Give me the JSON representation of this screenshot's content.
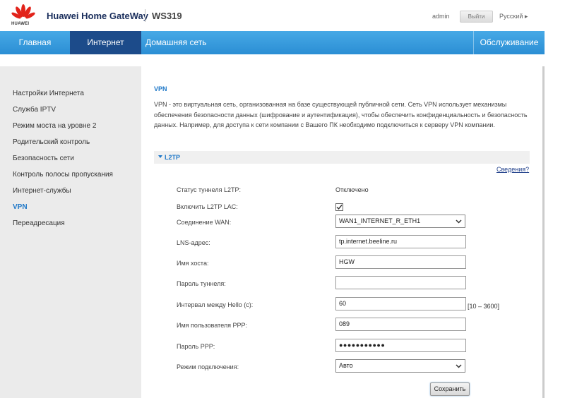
{
  "header": {
    "brand": "Huawei Home GateWay",
    "model": "WS319",
    "logo_text": "HUAWEI",
    "user": "admin",
    "logout": "Выйти",
    "language": "Русский ▸"
  },
  "nav": {
    "home": "Главная",
    "internet": "Интернет",
    "lan": "Домашняя сеть",
    "maintenance": "Обслуживание"
  },
  "sidebar": {
    "items": [
      {
        "label": "Настройки Интернета"
      },
      {
        "label": "Служба IPTV"
      },
      {
        "label": "Режим моста на уровне 2"
      },
      {
        "label": "Родительский контроль"
      },
      {
        "label": "Безопасность сети"
      },
      {
        "label": "Контроль полосы пропускания"
      },
      {
        "label": "Интернет-службы"
      },
      {
        "label": "VPN"
      },
      {
        "label": "Переадресация"
      }
    ],
    "active": "VPN"
  },
  "main": {
    "title": "VPN",
    "description": "VPN - это виртуальная сеть, организованная на базе существующей публичной сети. Сеть VPN использует механизмы обеспечения безопасности данных (шифрование и аутентификация), чтобы обеспечить конфиденциальность и безопасность данных. Например, для доступа к сети компании с Вашего ПК необходимо подключиться к серверу VPN компании.",
    "section": "L2TP",
    "details_link": "Сведения?",
    "form": {
      "tunnel_status_label": "Статус туннеля L2TP:",
      "tunnel_status_value": "Отключено",
      "enable_lac_label": "Включить L2TP LAC:",
      "enable_lac_checked": true,
      "wan_label": "Соединение WAN:",
      "wan_value": "WAN1_INTERNET_R_ETH1",
      "lns_label": "LNS-адрес:",
      "lns_value": "tp.internet.beeline.ru",
      "host_label": "Имя хоста:",
      "host_value": "HGW",
      "tunnel_pwd_label": "Пароль туннеля:",
      "tunnel_pwd_value": "",
      "hello_label": "Интервал между Hello (с):",
      "hello_value": "60",
      "hello_range": "[10 – 3600]",
      "ppp_user_label": "Имя пользователя PPP:",
      "ppp_user_value": "089",
      "ppp_pwd_label": "Пароль PPP:",
      "ppp_pwd_value": "●●●●●●●●●●●",
      "mode_label": "Режим подключения:",
      "mode_value": "Авто"
    },
    "save": "Сохранить"
  },
  "colors": {
    "nav_blue": "#2b8ed4",
    "nav_active": "#1c4b8a",
    "link_blue": "#1f78c8",
    "logo_red": "#e2231a"
  }
}
